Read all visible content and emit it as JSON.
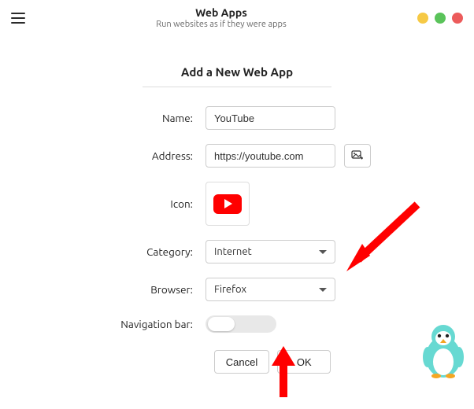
{
  "header": {
    "title": "Web Apps",
    "subtitle": "Run websites as if they were apps"
  },
  "dialog": {
    "title": "Add a New Web App"
  },
  "form": {
    "name_label": "Name:",
    "name_value": "YouTube",
    "address_label": "Address:",
    "address_value": "https://youtube.com",
    "icon_label": "Icon:",
    "icon_name": "youtube-icon",
    "category_label": "Category:",
    "category_value": "Internet",
    "browser_label": "Browser:",
    "browser_value": "Firefox",
    "navbar_label": "Navigation bar:",
    "navbar_on": false
  },
  "buttons": {
    "cancel": "Cancel",
    "ok": "OK"
  },
  "colors": {
    "arrow": "#ff0000",
    "mascot_body": "#67d9d2",
    "mascot_belly": "#ffffff",
    "mascot_beak": "#f5a623"
  }
}
